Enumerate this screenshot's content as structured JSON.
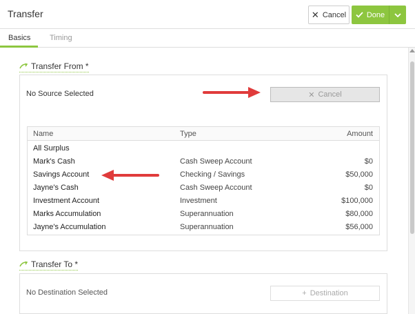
{
  "header": {
    "title": "Transfer",
    "cancel_label": "Cancel",
    "done_label": "Done"
  },
  "tabs": [
    {
      "label": "Basics",
      "active": true
    },
    {
      "label": "Timing",
      "active": false
    }
  ],
  "transfer_from": {
    "title": "Transfer From *",
    "status": "No Source Selected",
    "cancel_label": "Cancel",
    "columns": [
      "Name",
      "Type",
      "Amount"
    ],
    "rows": [
      {
        "name": "All Surplus",
        "type": "",
        "amount": ""
      },
      {
        "name": "Mark's Cash",
        "type": "Cash Sweep Account",
        "amount": "$0"
      },
      {
        "name": "Savings Account",
        "type": "Checking / Savings",
        "amount": "$50,000"
      },
      {
        "name": "Jayne's Cash",
        "type": "Cash Sweep Account",
        "amount": "$0"
      },
      {
        "name": "Investment Account",
        "type": "Investment",
        "amount": "$100,000"
      },
      {
        "name": "Marks Accumulation",
        "type": "Superannuation",
        "amount": "$80,000"
      },
      {
        "name": "Jayne's Accumulation",
        "type": "Superannuation",
        "amount": "$56,000"
      }
    ]
  },
  "transfer_to": {
    "title": "Transfer To *",
    "status": "No Destination Selected",
    "destination_label": "Destination"
  },
  "colors": {
    "accent": "#8dc63f",
    "arrow": "#e03b3b"
  }
}
